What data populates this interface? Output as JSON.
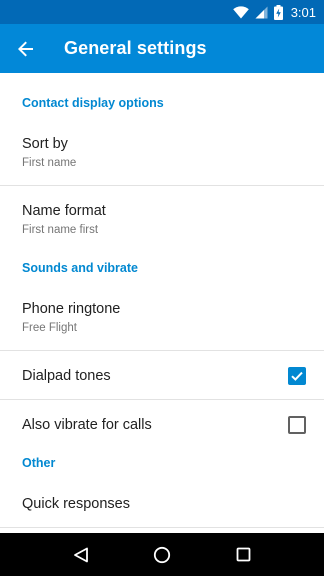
{
  "status_bar": {
    "time": "3:01",
    "battery_icon": "battery-charging-icon",
    "colors": {
      "background": "#0269b6"
    }
  },
  "app_bar": {
    "title": "General settings",
    "back_icon": "arrow-back-icon",
    "colors": {
      "background": "#0288d8",
      "text": "#ffffff"
    }
  },
  "sections": {
    "contact_display": {
      "header": "Contact display options",
      "sort_by": {
        "title": "Sort by",
        "summary": "First name"
      },
      "name_format": {
        "title": "Name format",
        "summary": "First name first"
      }
    },
    "sounds": {
      "header": "Sounds and vibrate",
      "ringtone": {
        "title": "Phone ringtone",
        "summary": "Free Flight"
      },
      "dialpad_tones": {
        "title": "Dialpad tones",
        "checked": true
      },
      "vibrate": {
        "title": "Also vibrate for calls",
        "checked": false
      }
    },
    "other": {
      "header": "Other",
      "quick_responses": {
        "title": "Quick responses"
      }
    }
  },
  "accent_color": "#0288d1",
  "nav_bar": {
    "icons": [
      "back-triangle-icon",
      "home-circle-icon",
      "recents-square-icon"
    ]
  }
}
